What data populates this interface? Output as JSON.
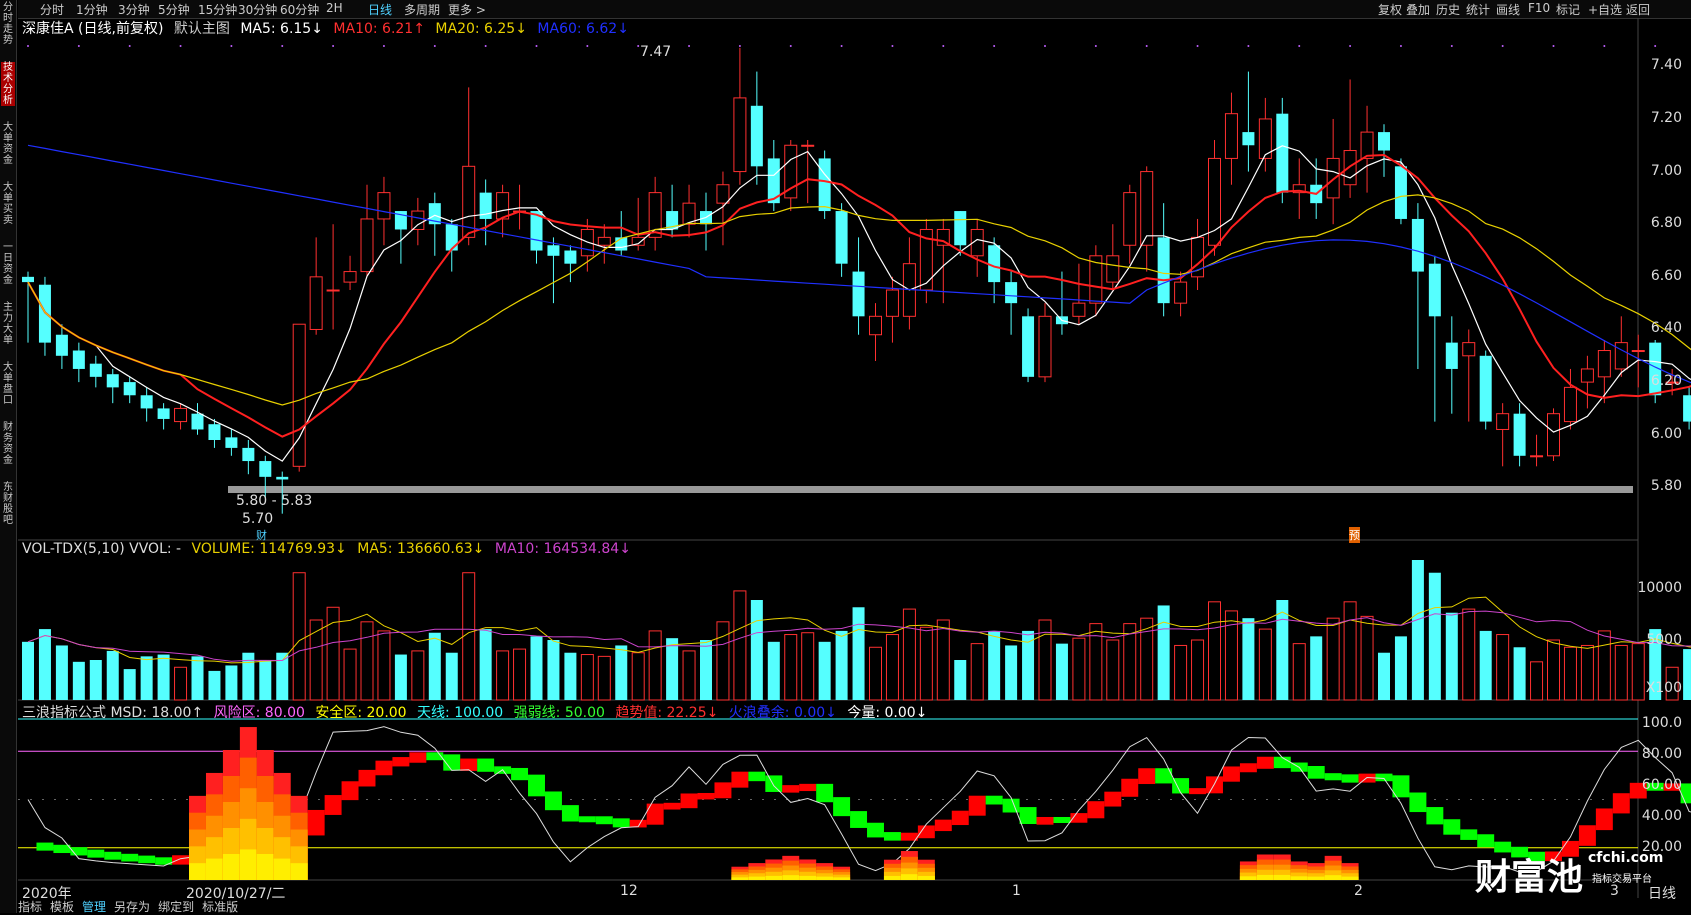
{
  "toolbar": {
    "left": [
      "分时",
      "1分钟",
      "3分钟",
      "5分钟",
      "15分钟",
      "30分钟",
      "60分钟",
      "2H",
      "日线",
      "多周期",
      "更多 >"
    ],
    "active": "日线",
    "right": [
      "复权",
      "叠加",
      "历史",
      "统计",
      "画线",
      "F10",
      "标记",
      "+自选",
      "返回"
    ]
  },
  "sidebar": [
    {
      "label": "分时走势",
      "active": false
    },
    {
      "label": "技术分析",
      "active": true
    },
    {
      "label": "大单资金",
      "active": false
    },
    {
      "label": "大单买卖",
      "active": false
    },
    {
      "label": "一日资金",
      "active": false
    },
    {
      "label": "主力大单",
      "active": false
    },
    {
      "label": "大单盘口",
      "active": false
    },
    {
      "label": "财务资金",
      "active": false
    },
    {
      "label": "东财股吧",
      "active": false
    }
  ],
  "main_legend": {
    "stock": "深康佳A (日线,前复权)",
    "template": "默认主图",
    "ma5": "MA5: 6.15↓",
    "ma10": "MA10: 6.21↑",
    "ma20": "MA20: 6.25↓",
    "ma60": "MA60: 6.62↓"
  },
  "vol_legend": {
    "name": "VOL-TDX(5,10) VVOL: -",
    "volume": "VOLUME: 114769.93↓",
    "ma5": "MA5: 136660.63↓",
    "ma10": "MA10: 164534.84↓"
  },
  "ind_legend": {
    "name": "三浪指标公式 MSD: 18.00↑",
    "risk": "风险区: 80.00",
    "safe": "安全区: 20.00",
    "sky": "天线: 100.00",
    "strong": "强弱线: 50.00",
    "trend": "趋势值: 22.25↓",
    "wave": "火浪叠余: 0.00↓",
    "today": "今量: 0.00↓"
  },
  "price_axis": [
    "7.40",
    "7.20",
    "7.00",
    "6.80",
    "6.60",
    "6.40",
    "6.20",
    "6.00",
    "5.80"
  ],
  "vol_axis": [
    "10000",
    "5000",
    "X100"
  ],
  "ind_axis": [
    "100.0",
    "80.00",
    "60.00",
    "40.00",
    "20.00"
  ],
  "date_axis": [
    {
      "label": "2020年"
    },
    {
      "label": "2020/10/27/二"
    },
    {
      "label": "12"
    },
    {
      "label": "1"
    },
    {
      "label": "2"
    },
    {
      "label": "3"
    },
    {
      "label": "日线"
    }
  ],
  "annotations": {
    "high": "7.47",
    "low_range": "5.80 - 5.83",
    "low": "5.70",
    "fin_mark": "财",
    "pre_mark": "预"
  },
  "bottom_tabs": [
    "指标",
    "模板",
    "管理",
    "另存为",
    "绑定到",
    "标准版"
  ],
  "watermark": {
    "brand": "财富池",
    "site": "cfchi.com",
    "slogan": "指标交易平台"
  },
  "colors": {
    "up": "#ff3030",
    "down": "#55ffff",
    "ma5": "#ffffff",
    "ma10": "#ff2020",
    "ma20": "#e8d000",
    "ma60": "#2030ff",
    "vma5": "#e8d000",
    "vma10": "#cc44cc"
  },
  "chart_data": {
    "type": "candlestick",
    "symbol": "深康佳A",
    "period": "日线",
    "ylim": [
      5.6,
      7.5
    ],
    "candles": [
      [
        6.6,
        6.58,
        6.62,
        6.35
      ],
      [
        6.57,
        6.35,
        6.6,
        6.3
      ],
      [
        6.38,
        6.3,
        6.42,
        6.25
      ],
      [
        6.32,
        6.25,
        6.35,
        6.2
      ],
      [
        6.27,
        6.22,
        6.3,
        6.18
      ],
      [
        6.23,
        6.18,
        6.25,
        6.12
      ],
      [
        6.2,
        6.15,
        6.22,
        6.12
      ],
      [
        6.15,
        6.1,
        6.18,
        6.05
      ],
      [
        6.1,
        6.06,
        6.12,
        6.02
      ],
      [
        6.05,
        6.1,
        6.12,
        6.02
      ],
      [
        6.08,
        6.02,
        6.12,
        6.0
      ],
      [
        6.04,
        5.98,
        6.06,
        5.95
      ],
      [
        5.99,
        5.95,
        6.02,
        5.92
      ],
      [
        5.95,
        5.9,
        5.98,
        5.85
      ],
      [
        5.9,
        5.84,
        5.92,
        5.76
      ],
      [
        5.84,
        5.83,
        5.86,
        5.7
      ],
      [
        5.88,
        6.42,
        6.42,
        5.86
      ],
      [
        6.4,
        6.6,
        6.75,
        6.38
      ],
      [
        6.55,
        6.55,
        6.8,
        6.4
      ],
      [
        6.58,
        6.62,
        6.68,
        6.55
      ],
      [
        6.62,
        6.82,
        6.95,
        6.6
      ],
      [
        6.82,
        6.92,
        6.98,
        6.72
      ],
      [
        6.85,
        6.78,
        6.85,
        6.65
      ],
      [
        6.78,
        6.85,
        6.9,
        6.72
      ],
      [
        6.88,
        6.8,
        6.92,
        6.68
      ],
      [
        6.8,
        6.7,
        6.82,
        6.62
      ],
      [
        6.75,
        7.02,
        7.32,
        6.72
      ],
      [
        6.92,
        6.82,
        6.97,
        6.72
      ],
      [
        6.82,
        6.92,
        6.95,
        6.75
      ],
      [
        6.85,
        6.85,
        6.95,
        6.78
      ],
      [
        6.85,
        6.7,
        6.85,
        6.65
      ],
      [
        6.72,
        6.68,
        6.75,
        6.5
      ],
      [
        6.7,
        6.65,
        6.72,
        6.58
      ],
      [
        6.68,
        6.78,
        6.82,
        6.62
      ],
      [
        6.72,
        6.75,
        6.8,
        6.65
      ],
      [
        6.75,
        6.7,
        6.85,
        6.68
      ],
      [
        6.72,
        6.75,
        6.9,
        6.7
      ],
      [
        6.75,
        6.92,
        6.98,
        6.7
      ],
      [
        6.85,
        6.78,
        6.95,
        6.75
      ],
      [
        6.8,
        6.88,
        6.95,
        6.75
      ],
      [
        6.85,
        6.8,
        6.92,
        6.7
      ],
      [
        6.88,
        6.95,
        7.0,
        6.72
      ],
      [
        7.0,
        7.28,
        7.47,
        6.95
      ],
      [
        7.25,
        7.02,
        7.38,
        6.95
      ],
      [
        7.05,
        6.88,
        7.12,
        6.85
      ],
      [
        6.9,
        7.1,
        7.12,
        6.85
      ],
      [
        7.1,
        7.1,
        7.12,
        6.88
      ],
      [
        7.05,
        6.85,
        7.08,
        6.82
      ],
      [
        6.85,
        6.65,
        6.88,
        6.6
      ],
      [
        6.62,
        6.45,
        6.75,
        6.38
      ],
      [
        6.38,
        6.45,
        6.5,
        6.28
      ],
      [
        6.45,
        6.55,
        6.6,
        6.35
      ],
      [
        6.45,
        6.65,
        6.75,
        6.4
      ],
      [
        6.55,
        6.78,
        6.82,
        6.5
      ],
      [
        6.72,
        6.78,
        6.82,
        6.5
      ],
      [
        6.85,
        6.72,
        6.85,
        6.68
      ],
      [
        6.68,
        6.78,
        6.82,
        6.6
      ],
      [
        6.72,
        6.58,
        6.75,
        6.5
      ],
      [
        6.58,
        6.5,
        6.62,
        6.38
      ],
      [
        6.45,
        6.22,
        6.48,
        6.2
      ],
      [
        6.22,
        6.45,
        6.5,
        6.2
      ],
      [
        6.45,
        6.42,
        6.62,
        6.38
      ],
      [
        6.45,
        6.5,
        6.65,
        6.42
      ],
      [
        6.5,
        6.68,
        6.72,
        6.45
      ],
      [
        6.58,
        6.68,
        6.8,
        6.55
      ],
      [
        6.72,
        6.92,
        6.95,
        6.65
      ],
      [
        6.72,
        7.0,
        7.02,
        6.62
      ],
      [
        6.75,
        6.5,
        6.88,
        6.45
      ],
      [
        6.5,
        6.58,
        6.62,
        6.45
      ],
      [
        6.6,
        6.75,
        6.82,
        6.55
      ],
      [
        6.72,
        7.05,
        7.12,
        6.68
      ],
      [
        7.05,
        7.22,
        7.3,
        6.95
      ],
      [
        7.15,
        7.1,
        7.38,
        7.0
      ],
      [
        7.05,
        7.2,
        7.28,
        7.0
      ],
      [
        7.22,
        6.92,
        7.28,
        6.88
      ],
      [
        6.92,
        6.95,
        7.05,
        6.82
      ],
      [
        6.95,
        6.88,
        7.05,
        6.82
      ],
      [
        6.9,
        7.05,
        7.2,
        6.8
      ],
      [
        6.95,
        7.08,
        7.35,
        6.9
      ],
      [
        7.05,
        7.15,
        7.25,
        6.92
      ],
      [
        7.15,
        7.08,
        7.18,
        6.98
      ],
      [
        7.02,
        6.82,
        7.05,
        6.8
      ],
      [
        6.82,
        6.62,
        6.88,
        6.25
      ],
      [
        6.65,
        6.45,
        6.68,
        6.05
      ],
      [
        6.35,
        6.25,
        6.45,
        6.08
      ],
      [
        6.3,
        6.35,
        6.4,
        6.05
      ],
      [
        6.3,
        6.05,
        6.32,
        6.02
      ],
      [
        6.02,
        6.08,
        6.12,
        5.88
      ],
      [
        6.08,
        5.92,
        6.12,
        5.88
      ],
      [
        5.92,
        5.92,
        6.0,
        5.88
      ],
      [
        5.92,
        6.08,
        6.1,
        5.9
      ],
      [
        6.05,
        6.18,
        6.25,
        6.02
      ],
      [
        6.2,
        6.25,
        6.3,
        6.1
      ],
      [
        6.22,
        6.32,
        6.36,
        6.12
      ],
      [
        6.25,
        6.35,
        6.45,
        6.22
      ],
      [
        6.32,
        6.32,
        6.38,
        6.18
      ],
      [
        6.35,
        6.15,
        6.36,
        6.12
      ],
      [
        6.2,
        6.2,
        6.25,
        6.15
      ],
      [
        6.15,
        6.05,
        6.18,
        6.02
      ],
      [
        6.1,
        6.18,
        6.22,
        6.02
      ],
      [
        6.22,
        6.15,
        6.25,
        6.1
      ]
    ],
    "candle_order": "open,close,high,low"
  }
}
